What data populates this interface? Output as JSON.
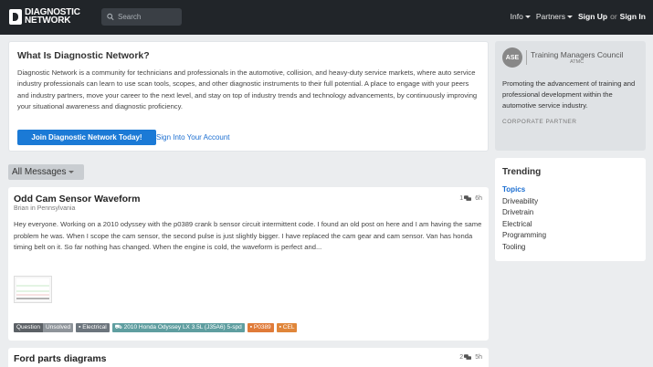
{
  "header": {
    "logo_line1": "DIAGNOSTIC",
    "logo_line2": "NETWORK",
    "search_placeholder": "Search",
    "info_label": "Info",
    "partners_label": "Partners",
    "signup_label": "Sign Up",
    "or_label": "or",
    "signin_label": "Sign In"
  },
  "intro": {
    "title": "What Is Diagnostic Network?",
    "text": "Diagnostic Network is a community for technicians and professionals in the automotive, collision, and heavy-duty service markets, where auto service industry professionals can learn to use scan tools, scopes, and other diagnostic instruments to their full potential. A place to engage with your peers and industry partners, move your career to the next level, and stay on top of industry trends and technology advancements, by continuously improving your situational awareness and diagnostic proficiency.",
    "join_label": "Join Diagnostic Network Today!",
    "signin_link": "Sign Into Your Account"
  },
  "filter": {
    "label": "All Messages"
  },
  "posts": [
    {
      "title": "Odd Cam Sensor Waveform",
      "author": "Brian",
      "in_label": "in",
      "location": "Pennsylvania",
      "replies": "1",
      "age": "6h",
      "body": "Hey everyone. Working on a 2010 odyssey with the p0389 crank b sensor circuit intermittent code. I found an old post on here and I am having the same problem he was. When I scope the cam sensor, the second pulse is just slightly bigger. I have replaced the cam gear and cam sensor. Van has honda timing belt on it. So far nothing has changed. When the engine is cold, the waveform is perfect and...",
      "tags": {
        "type": "Question",
        "status": "Unsolved",
        "category": "Electrical",
        "vehicle": "2010 Honda Odyssey LX 3.5L (J35A6) 5-spd",
        "code": "P0389",
        "cel": "CEL"
      }
    },
    {
      "title": "Ford parts diagrams",
      "replies": "2",
      "age": "5h"
    }
  ],
  "sponsor": {
    "ase": "ASE",
    "name": "Training Managers Council",
    "sub": "ATMC",
    "text": "Promoting the advancement of training and professional development within the automotive service industry.",
    "label": "CORPORATE PARTNER"
  },
  "trending": {
    "title": "Trending",
    "items": [
      "Topics",
      "Driveability",
      "Drivetrain",
      "Electrical",
      "Programming",
      "Tooling"
    ]
  },
  "colors": {
    "topbar": "#212529",
    "primary": "#1b7ad6",
    "link": "#1b6ed1"
  }
}
